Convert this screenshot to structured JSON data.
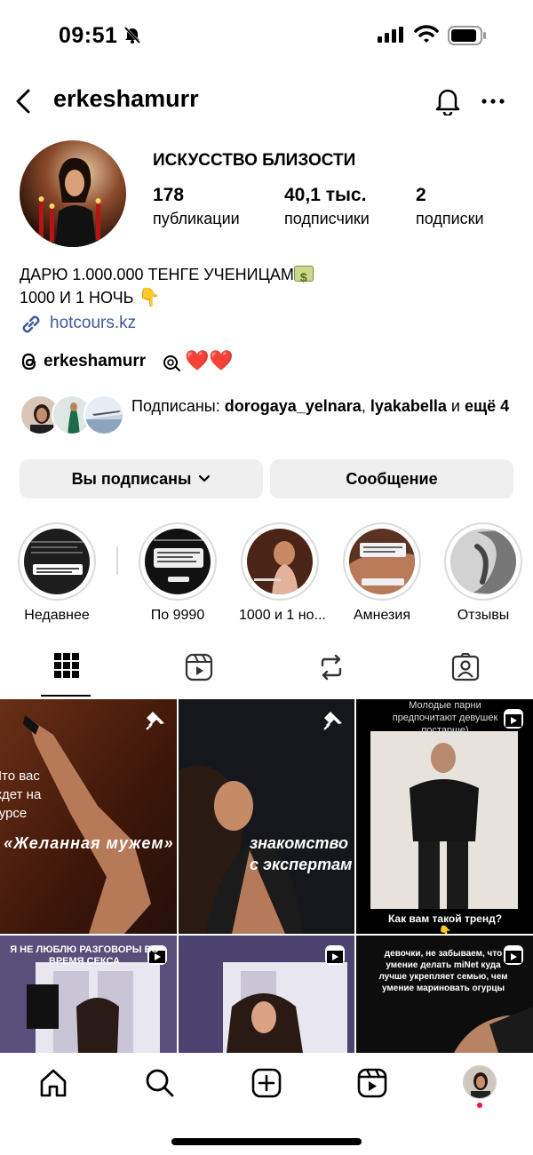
{
  "status_bar": {
    "time": "09:51"
  },
  "header": {
    "username": "erkeshamurr"
  },
  "profile": {
    "name": "ИСКУССТВО БЛИЗОСТИ",
    "stats": [
      {
        "value": "178",
        "label": "публикации"
      },
      {
        "value": "40,1 тыс.",
        "label": "подписчики"
      },
      {
        "value": "2",
        "label": "подписки"
      }
    ],
    "bio_line1": "ДАРЮ 1.000.000 ТЕНГЕ УЧЕНИЦАМ",
    "bio_line2": "1000 И 1 НОЧЬ",
    "link": "hotcours.kz",
    "threads_handle": "erkeshamurr",
    "hearts": "❤️❤️",
    "followed_prefix": "Подписаны: ",
    "followed_user1": "dorogaya_yelnara",
    "followed_sep": ", ",
    "followed_user2": "lyakabella",
    "followed_and": " и ",
    "followed_more": "ещё 4"
  },
  "buttons": {
    "following": "Вы подписаны",
    "message": "Сообщение"
  },
  "highlights": [
    {
      "label": "Недавнее"
    },
    {
      "label": "По 9990"
    },
    {
      "label": "1000 и 1 но..."
    },
    {
      "label": "Амнезия"
    },
    {
      "label": "Отзывы"
    }
  ],
  "grid": {
    "post1_caption_a": "Что вас",
    "post1_caption_b": "ждет на",
    "post1_caption_c": "курсе",
    "post1_caption_d": "«Желанная мужем»",
    "post2_caption_a": "знакомство",
    "post2_caption_b": "с экспертам",
    "post3_top": "Молодые парни предпочитают девушек постарше)",
    "post3_bottom": "Как вам такой тренд?",
    "post4_caption": "я не люблю разговоры во время секса",
    "post6_caption": "девочки, не забываем, что умение делать miNet куда лучше укрепляет семью, чем умение мариновать огурцы"
  },
  "colors": {
    "link": "#3d5a9c",
    "button_bg": "#efefef",
    "heart": "#e0162b",
    "notif_dot": "#ff0f3d"
  }
}
